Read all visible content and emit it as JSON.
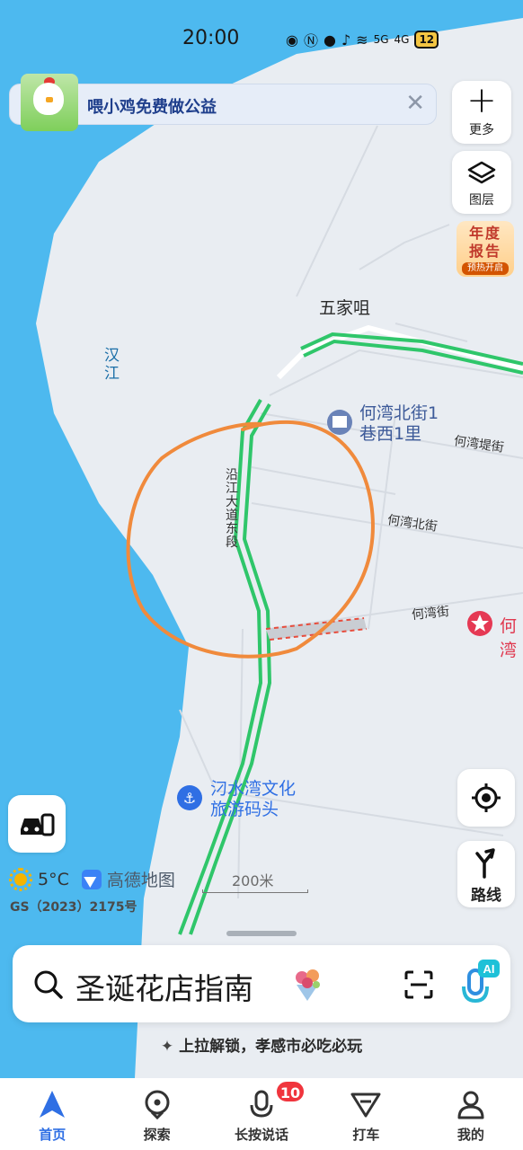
{
  "status_bar": {
    "time": "20:00",
    "battery": "12",
    "signal_1": "5G",
    "signal_2": "4G"
  },
  "banner": {
    "text": "喂小鸡免费做公益",
    "close": "✕"
  },
  "map": {
    "labels": {
      "river": "汉\n江",
      "area": "五家咀",
      "road_main": "沿江大道东段",
      "street_hewan_di": "何湾堤街",
      "street_hewan_bei": "何湾北街",
      "street_hewan": "何湾街",
      "poi_1": "何湾北街1",
      "poi_1_line2": "巷西1里",
      "poi_red": "何湾",
      "poi_dock": "汈水湾文化",
      "poi_dock_line2": "旅游码头"
    }
  },
  "right_controls": {
    "more": "更多",
    "layers": "图层",
    "annual_line1": "年度",
    "annual_line2": "报告",
    "annual_badge": "预热开启",
    "route": "路线"
  },
  "weather": {
    "temp": "5°C",
    "brand": "高德地图",
    "license": "GS（2023）2175号",
    "scale": "200米"
  },
  "search": {
    "text": "圣诞花店指南"
  },
  "hint": {
    "text": "上拉解锁，孝感市必吃必玩"
  },
  "bottom_nav": {
    "items": [
      {
        "label": "首页"
      },
      {
        "label": "探索"
      },
      {
        "label": "长按说话"
      },
      {
        "label": "打车"
      },
      {
        "label": "我的"
      }
    ],
    "badge": "10"
  }
}
